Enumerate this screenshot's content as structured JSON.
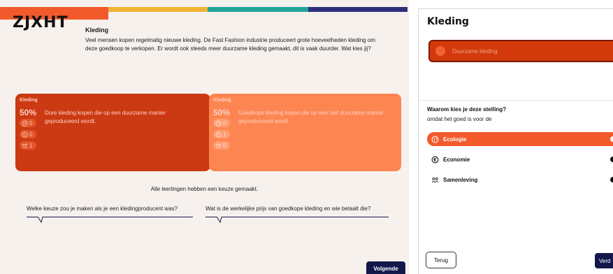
{
  "app": {
    "logo": "ZJXHT"
  },
  "intro": {
    "title": "Kleding",
    "text": "Veel mensen kopen regelmatig nieuwe kleding. De Fast Fashion industrie produceert grote hoeveelheden kleding om deze goedkoop te verkopen. Er wordt ook steeds meer duurzame kleding gemaakt, dit is vaak duurder. Wat kies jij?"
  },
  "cards": [
    {
      "category": "Kleding",
      "percent": "50%",
      "statement": "Dure kleding kopen die op een duurzame manier geproduceerd wordt.",
      "counts": {
        "ecology": "0",
        "economy": "0",
        "society": "1"
      }
    },
    {
      "category": "Kleding",
      "percent": "50%",
      "statement": "Goedkope kleding kopen die op een niet duurzame manier geproduceerd wordt.",
      "counts": {
        "ecology": "0",
        "economy": "1",
        "society": "0"
      }
    }
  ],
  "status": "Alle leerlingen hebben een keuze gemaakt.",
  "questions": [
    "Welke keuze zou je maken als je een kledingproducent was?",
    "Wat is de werkelijke prijs van goedkope kleding en wie betaalt die?"
  ],
  "buttons": {
    "next": "Volgende",
    "back": "Terug",
    "continue_partial": "Verd"
  },
  "panel": {
    "title": "Kleding",
    "selected_choice": "Duurzame kleding",
    "question": "Waarom kies je deze stelling?",
    "subtext": "omdat het goed is voor de",
    "options": [
      {
        "label": "Ecologie",
        "icon": "globe-icon",
        "selected": true
      },
      {
        "label": "Economie",
        "icon": "euro-icon",
        "selected": false
      },
      {
        "label": "Samenleving",
        "icon": "people-icon",
        "selected": false
      }
    ]
  },
  "colors": {
    "stripe": [
      "#f25a2b",
      "#f2b233",
      "#22a59b",
      "#2d2f7a"
    ],
    "card_a": "#cb3a12",
    "card_b": "#fd8552",
    "accent": "#f25a2b",
    "navy": "#12184a"
  }
}
